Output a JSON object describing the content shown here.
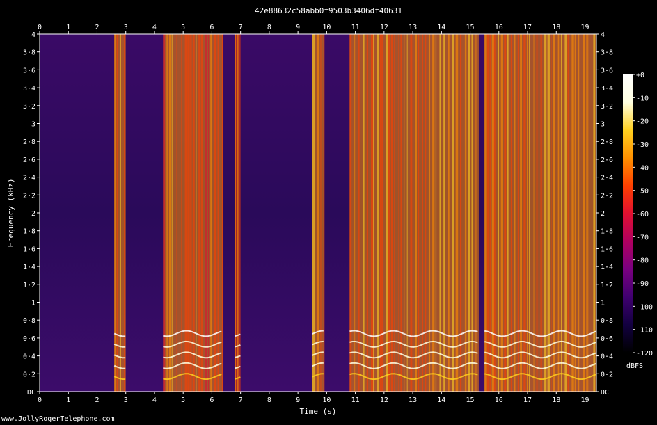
{
  "title": "42e88632c58abb0f9503b3406df40631",
  "footer": "www.JollyRogerTelephone.com",
  "chart_data": {
    "type": "heatmap",
    "xlabel": "Time (s)",
    "ylabel": "Frequency (kHz)",
    "xlim": [
      0,
      19.4
    ],
    "ylim": [
      0,
      4
    ],
    "x_ticks": [
      "0",
      "1",
      "2",
      "3",
      "4",
      "5",
      "6",
      "7",
      "8",
      "9",
      "10",
      "11",
      "12",
      "13",
      "14",
      "15",
      "16",
      "17",
      "18",
      "19"
    ],
    "x_tick_values": [
      0,
      1,
      2,
      3,
      4,
      5,
      6,
      7,
      8,
      9,
      10,
      11,
      12,
      13,
      14,
      15,
      16,
      17,
      18,
      19
    ],
    "y_ticks": [
      "DC",
      "0·2",
      "0·4",
      "0·6",
      "0·8",
      "1",
      "1·2",
      "1·4",
      "1·6",
      "1·8",
      "2",
      "2·2",
      "2·4",
      "2·6",
      "2·8",
      "3",
      "3·2",
      "3·4",
      "3·6",
      "3·8",
      "4"
    ],
    "y_tick_values": [
      0,
      0.2,
      0.4,
      0.6,
      0.8,
      1,
      1.2,
      1.4,
      1.6,
      1.8,
      2,
      2.2,
      2.4,
      2.6,
      2.8,
      3,
      3.2,
      3.4,
      3.6,
      3.8,
      4
    ],
    "colorbar": {
      "label": "dBFS",
      "range": [
        -120,
        0
      ],
      "ticks": [
        "+0",
        "-10",
        "-20",
        "-30",
        "-40",
        "-50",
        "-60",
        "-70",
        "-80",
        "-90",
        "-100",
        "-110",
        "-120"
      ],
      "tick_values": [
        0,
        -10,
        -20,
        -30,
        -40,
        -50,
        -60,
        -70,
        -80,
        -90,
        -100,
        -110,
        -120
      ],
      "stops": [
        "#000000",
        "#120040",
        "#400070",
        "#7a0080",
        "#b00060",
        "#e01030",
        "#ff4000",
        "#ff9000",
        "#ffd020",
        "#ffffe0",
        "#ffffff"
      ]
    },
    "speech_segments": [
      {
        "start": 2.6,
        "end": 3.0,
        "level": -45
      },
      {
        "start": 4.3,
        "end": 6.4,
        "level": -45
      },
      {
        "start": 6.8,
        "end": 7.0,
        "level": -50
      },
      {
        "start": 9.5,
        "end": 9.9,
        "level": -45
      },
      {
        "start": 10.8,
        "end": 15.3,
        "level": -40
      },
      {
        "start": 15.5,
        "end": 19.4,
        "level": -40
      }
    ],
    "background_level": -95
  }
}
